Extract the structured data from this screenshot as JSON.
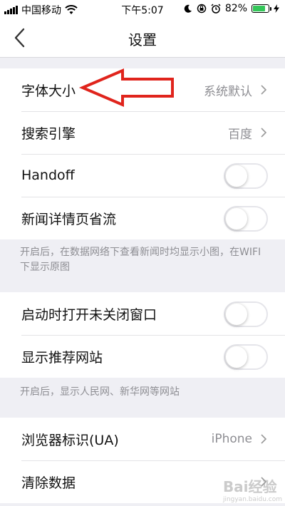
{
  "status_bar": {
    "carrier": "中国移动",
    "time": "下午5:07",
    "battery": "82%",
    "battery_level": 0.82,
    "icons": [
      "signal-icon",
      "wifi-icon",
      "moon-icon",
      "lock-rotation-icon",
      "alarm-icon",
      "battery-icon",
      "charging-icon"
    ]
  },
  "nav": {
    "title": "设置",
    "back_icon": "chevron-left-icon"
  },
  "group1": {
    "font_size": {
      "label": "字体大小",
      "value": "系统默认"
    },
    "search_engine": {
      "label": "搜索引擎",
      "value": "百度"
    },
    "handoff": {
      "label": "Handoff",
      "on": false
    },
    "news_saver": {
      "label": "新闻详情页省流",
      "on": false
    }
  },
  "footnote1": "开启后，在数据网络下查看新闻时均显示小图，在WIFI下显示原图",
  "group2": {
    "restore_tabs": {
      "label": "启动时打开未关闭窗口",
      "on": false
    },
    "recommended_sites": {
      "label": "显示推荐网站",
      "on": false
    }
  },
  "footnote2": "开启后，显示人民网、新华网等网站",
  "group3": {
    "user_agent": {
      "label": "浏览器标识(UA)",
      "value": "iPhone"
    },
    "clear_data": {
      "label": "清除数据"
    }
  },
  "annotation": {
    "arrow_color": "#e0241c"
  },
  "watermark": {
    "text": "Bai经验",
    "sub": "jingyan.baidu.com"
  },
  "colors": {
    "accent_green": "#34c759",
    "background": "#efeff4",
    "secondary_text": "#8e8e93"
  }
}
